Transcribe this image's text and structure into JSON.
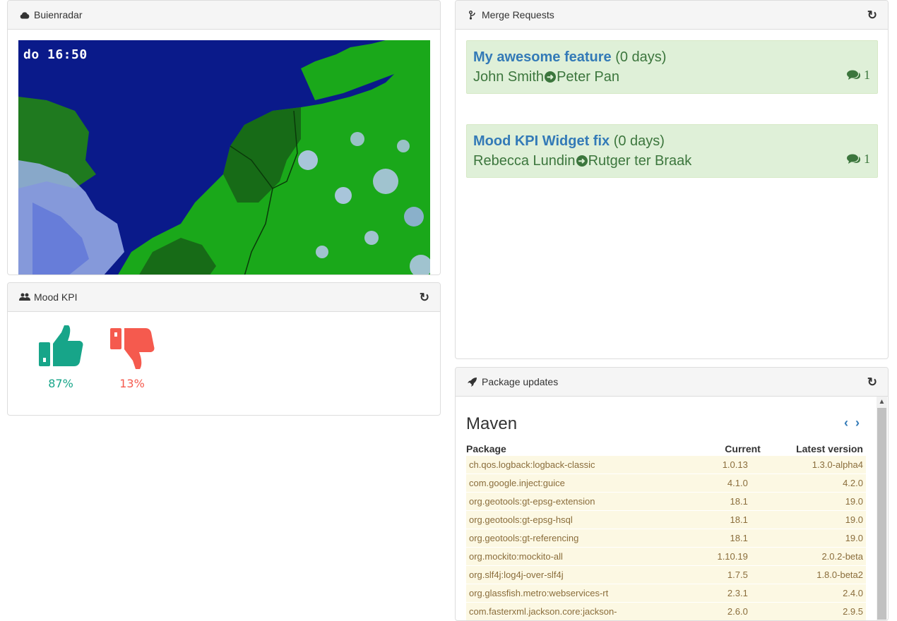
{
  "buienradar": {
    "title": "Buienradar",
    "icon": "cloud-icon",
    "time": "do 16:50"
  },
  "mood": {
    "title": "Mood KPI",
    "icon": "users-icon",
    "positive_pct": "87%",
    "negative_pct": "13%",
    "positive_color": "#17a589",
    "negative_color": "#f55a4e"
  },
  "merge_requests": {
    "title": "Merge Requests",
    "icon": "code-fork-icon",
    "items": [
      {
        "title": "My awesome feature",
        "age": "(0 days)",
        "author": "John Smith",
        "assignee": "Peter Pan",
        "comments": "1"
      },
      {
        "title": "Mood KPI Widget fix",
        "age": "(0 days)",
        "author": "Rebecca Lundin",
        "assignee": "Rutger ter Braak",
        "comments": "1"
      }
    ]
  },
  "packages": {
    "title": "Package updates",
    "icon": "rocket-icon",
    "section": "Maven",
    "columns": [
      "Package",
      "Current",
      "Latest version"
    ],
    "rows": [
      [
        "ch.qos.logback:logback-classic",
        "1.0.13",
        "1.3.0-alpha4"
      ],
      [
        "com.google.inject:guice",
        "4.1.0",
        "4.2.0"
      ],
      [
        "org.geotools:gt-epsg-extension",
        "18.1",
        "19.0"
      ],
      [
        "org.geotools:gt-epsg-hsql",
        "18.1",
        "19.0"
      ],
      [
        "org.geotools:gt-referencing",
        "18.1",
        "19.0"
      ],
      [
        "org.mockito:mockito-all",
        "1.10.19",
        "2.0.2-beta"
      ],
      [
        "org.slf4j:log4j-over-slf4j",
        "1.7.5",
        "1.8.0-beta2"
      ],
      [
        "org.glassfish.metro:webservices-rt",
        "2.3.1",
        "2.4.0"
      ],
      [
        "com.fasterxml.jackson.core:jackson-",
        "2.6.0",
        "2.9.5"
      ]
    ]
  }
}
